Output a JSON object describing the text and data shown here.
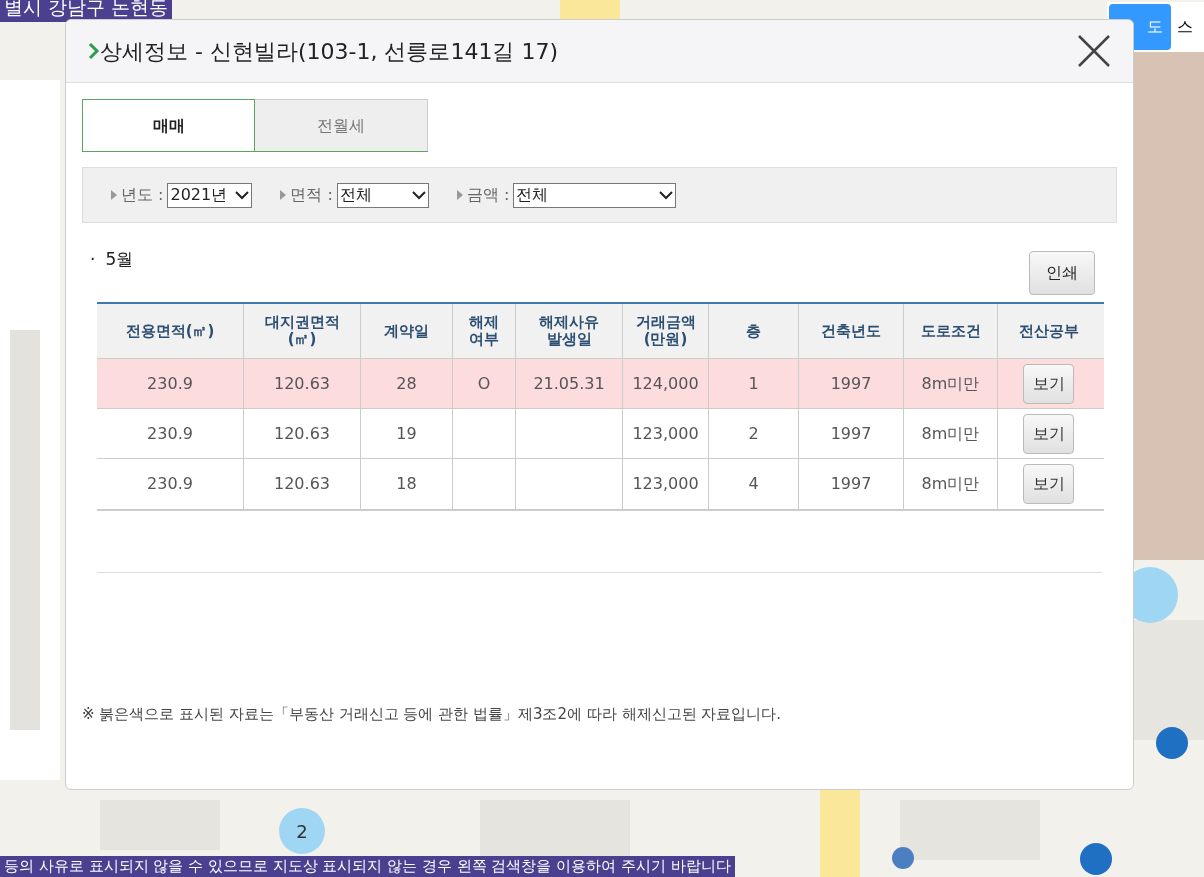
{
  "map_overlays": {
    "region_banner": "별시 강남구 논현동",
    "notice_banner": "등의 사유로 표시되지 않을 수 있으므로 지도상 표시되지 않는 경우 왼쪽 검색창을 이용하여 주시기 바랍니다",
    "map_type_buttons": [
      {
        "label": "도",
        "selected": true
      },
      {
        "label": "스",
        "selected": false
      }
    ],
    "cluster_count": "2"
  },
  "dialog": {
    "title": "상세정보 - 신현빌라(103-1, 선릉로141길 17)",
    "tabs": [
      {
        "label": "매매",
        "selected": true
      },
      {
        "label": "전월세",
        "selected": false
      }
    ],
    "filters": [
      {
        "label": "년도 :",
        "value": "2021년"
      },
      {
        "label": "면적 :",
        "value": "전체"
      },
      {
        "label": "금액 :",
        "value": "전체"
      }
    ],
    "month_bullet": "·",
    "month": "5월",
    "print_button": "인쇄",
    "table": {
      "columns": [
        "전용면적(㎡)",
        "대지권면적\n(㎡)",
        "계약일",
        "해제\n여부",
        "해제사유\n발생일",
        "거래금액\n(만원)",
        "층",
        "건축년도",
        "도로조건",
        "전산공부"
      ],
      "rows": [
        {
          "cells": [
            "230.9",
            "120.63",
            "28",
            "O",
            "21.05.31",
            "124,000",
            "1",
            "1997",
            "8m미만"
          ],
          "button": "보기",
          "cancelled": true
        },
        {
          "cells": [
            "230.9",
            "120.63",
            "19",
            "",
            "",
            "123,000",
            "2",
            "1997",
            "8m미만"
          ],
          "button": "보기",
          "cancelled": false
        },
        {
          "cells": [
            "230.9",
            "120.63",
            "18",
            "",
            "",
            "123,000",
            "4",
            "1997",
            "8m미만"
          ],
          "button": "보기",
          "cancelled": false
        }
      ]
    },
    "footnote": "※ 붉은색으로 표시된 자료는「부동산 거래신고 등에 관한 법률」제3조2에 따라 해제신고된 자료입니다."
  }
}
